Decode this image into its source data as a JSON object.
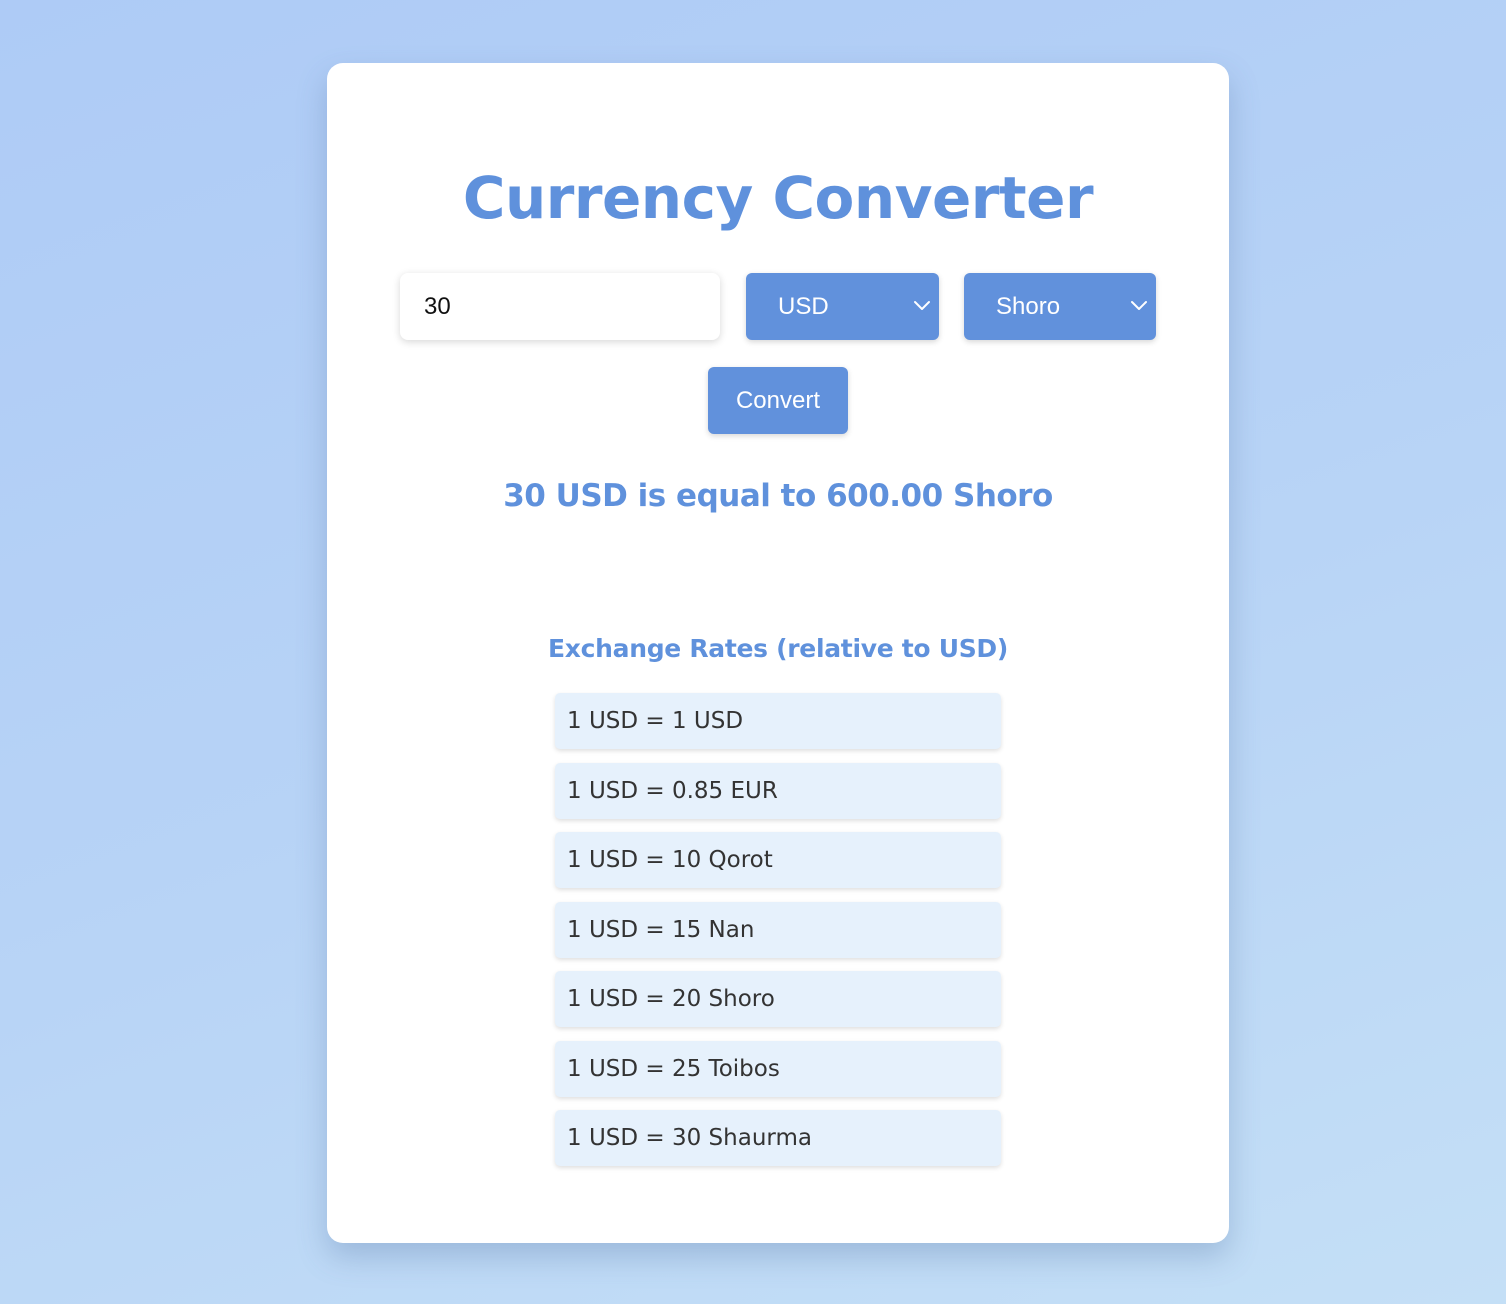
{
  "colors": {
    "accent": "#6191dc",
    "card": "#ffffff",
    "rate_item_bg": "#e6f1fc",
    "background": "#b7d3f6"
  },
  "title": "Currency Converter",
  "amount_input": {
    "value": "30"
  },
  "from_currency": {
    "selected": "USD",
    "icon": "chevron-down-icon"
  },
  "to_currency": {
    "selected": "Shoro",
    "icon": "chevron-down-icon"
  },
  "convert_button": "Convert",
  "result": "30 USD is equal to 600.00 Shoro",
  "rates": {
    "title": "Exchange Rates (relative to USD)",
    "items": [
      "1 USD = 1 USD",
      "1 USD = 0.85 EUR",
      "1 USD = 10 Qorot",
      "1 USD = 15 Nan",
      "1 USD = 20 Shoro",
      "1 USD = 25 Toibos",
      "1 USD = 30 Shaurma"
    ]
  }
}
